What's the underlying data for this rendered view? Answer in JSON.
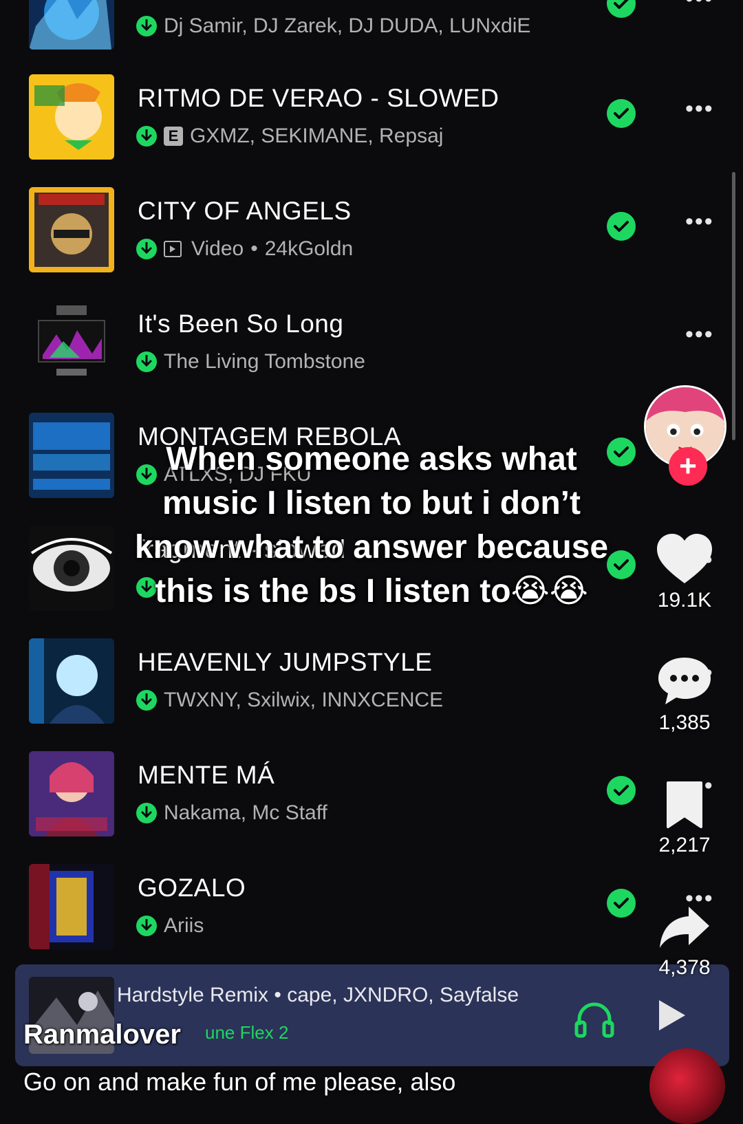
{
  "tracks": [
    {
      "title": "",
      "artists": "Dj Samir, DJ Zarek, DJ DUDA, LUNxdiE",
      "explicit": false,
      "video": false,
      "downloaded": true,
      "saved": true
    },
    {
      "title": "RITMO DE VERAO - SLOWED",
      "artists": "GXMZ, SEKIMANE, Repsaj",
      "explicit": true,
      "video": false,
      "downloaded": true,
      "saved": true
    },
    {
      "title": "CITY OF ANGELS",
      "artists": "24kGoldn",
      "type_label": "Video",
      "explicit": false,
      "video": true,
      "downloaded": true,
      "saved": true
    },
    {
      "title": "It's Been So Long",
      "artists": "The Living Tombstone",
      "explicit": false,
      "video": false,
      "downloaded": true,
      "saved": false
    },
    {
      "title": "MONTAGEM REBOLA",
      "artists": "ATLXS, DJ FKU",
      "explicit": false,
      "video": false,
      "downloaded": true,
      "saved": true
    },
    {
      "title": "fragment - slowed",
      "artists": "",
      "explicit": false,
      "video": false,
      "downloaded": true,
      "saved": true
    },
    {
      "title": "HEAVENLY JUMPSTYLE",
      "artists": "TWXNY, Sxilwix, INNXCENCE",
      "explicit": false,
      "video": false,
      "downloaded": true,
      "saved": false
    },
    {
      "title": "MENTE MÁ",
      "artists": "Nakama, Mc Staff",
      "explicit": false,
      "video": false,
      "downloaded": true,
      "saved": true
    },
    {
      "title": "GOZALO",
      "artists": "Ariis",
      "explicit": false,
      "video": false,
      "downloaded": true,
      "saved": true
    }
  ],
  "explicit_badge": "E",
  "separator": "•",
  "more_glyph": "•••",
  "now_playing": {
    "title": "Hardstyle Remix • cape, JXNDRO, Sayfalse",
    "device": "une Flex 2"
  },
  "caption": "When someone asks what music I listen to but i don’t know what to answer because this is the bs I listen to😭😭",
  "side_rail": {
    "likes": "19.1K",
    "comments": "1,385",
    "saves": "2,217",
    "shares": "4,378",
    "follow_glyph": "+"
  },
  "author": {
    "username": "Ranmalover",
    "description": "Go on and make fun of me please, also"
  },
  "colors": {
    "spotify_green": "#1ed760",
    "tiktok_red": "#fe2c55",
    "nowplaying_bg": "#2b3358",
    "background": "#0b0b0d"
  },
  "icons": {
    "download": "download-icon",
    "saved": "check-circle-icon",
    "more": "more-options-icon",
    "like": "heart-icon",
    "comment": "comment-icon",
    "save": "bookmark-icon",
    "share": "share-icon",
    "headphones": "headphones-icon",
    "play": "play-icon"
  }
}
